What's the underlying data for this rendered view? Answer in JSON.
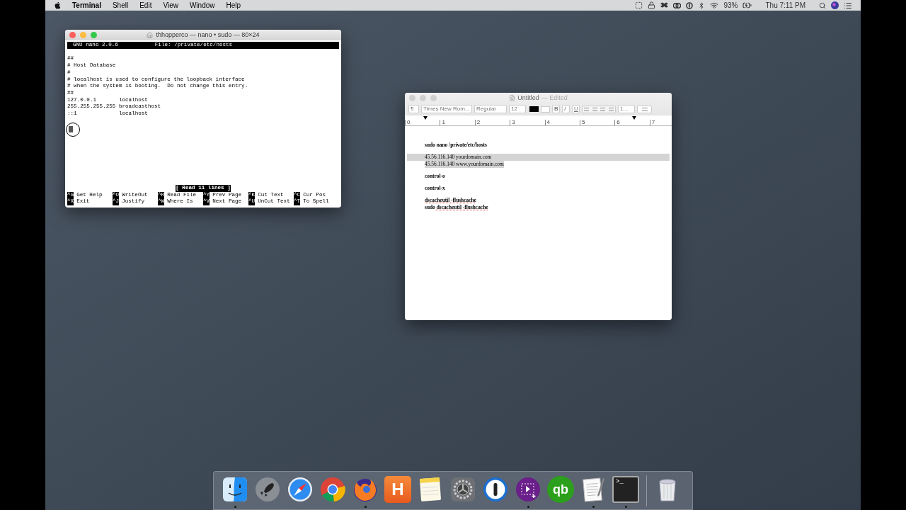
{
  "menu_bar": {
    "app": "Terminal",
    "items": [
      "Shell",
      "Edit",
      "View",
      "Window",
      "Help"
    ],
    "battery": "93%",
    "clock": "Thu 7:11 PM"
  },
  "terminal": {
    "title": "thhopperco — nano • sudo — 80×24",
    "header_left": "GNU nano 2.0.6",
    "header_file": "File: /private/etc/hosts",
    "lines": [
      "##",
      "# Host Database",
      "#",
      "# localhost is used to configure the loopback interface",
      "# when the system is booting.  Do not change this entry.",
      "##",
      "127.0.0.1       localhost",
      "255.255.255.255 broadcasthost",
      "::1             localhost"
    ],
    "status": "[ Read 11 lines ]",
    "shortcuts": [
      {
        "key": "^G",
        "label": "Get Help"
      },
      {
        "key": "^O",
        "label": "WriteOut"
      },
      {
        "key": "^R",
        "label": "Read File"
      },
      {
        "key": "^Y",
        "label": "Prev Page"
      },
      {
        "key": "^K",
        "label": "Cut Text"
      },
      {
        "key": "^C",
        "label": "Cur Pos"
      },
      {
        "key": "^X",
        "label": "Exit"
      },
      {
        "key": "^J",
        "label": "Justify"
      },
      {
        "key": "^W",
        "label": "Where Is"
      },
      {
        "key": "^V",
        "label": "Next Page"
      },
      {
        "key": "^U",
        "label": "UnCut Text"
      },
      {
        "key": "^T",
        "label": "To Spell"
      }
    ]
  },
  "textedit": {
    "title": "Untitled",
    "edited": "— Edited",
    "toolbar": {
      "paragraph": "¶",
      "font": "Times New Rom...",
      "style": "Regular",
      "size": "12",
      "bold": "B",
      "italic": "I",
      "underline": "U",
      "spacing": "1..."
    },
    "ruler": [
      "0",
      "1",
      "2",
      "3",
      "4",
      "5",
      "6",
      "7"
    ],
    "lines": [
      {
        "gap": false,
        "bold": true,
        "selected": false,
        "segments": [
          {
            "text": "sudo nano /private/etc/hosts",
            "misspelled": false
          }
        ]
      },
      {
        "gap": true,
        "bold": false,
        "selected": true,
        "segments": [
          {
            "text": "45.56.116.140 yourdomain.com",
            "misspelled": false
          }
        ]
      },
      {
        "gap": false,
        "bold": false,
        "selected": true,
        "segments": [
          {
            "text": "45.56.116.140 www.yourdomain.com",
            "misspelled": false
          }
        ]
      },
      {
        "gap": true,
        "bold": true,
        "selected": false,
        "segments": [
          {
            "text": "control-o",
            "misspelled": false
          }
        ]
      },
      {
        "gap": true,
        "bold": true,
        "selected": false,
        "segments": [
          {
            "text": "control-x",
            "misspelled": false
          }
        ]
      },
      {
        "gap": true,
        "bold": true,
        "selected": false,
        "segments": [
          {
            "text": "dscacheutil -flushcache",
            "misspelled": true
          }
        ]
      },
      {
        "gap": false,
        "bold": true,
        "selected": false,
        "segments": [
          {
            "text": "sudo ",
            "misspelled": false
          },
          {
            "text": "dscacheutil -flushcache",
            "misspelled": true
          }
        ]
      }
    ]
  },
  "dock": [
    {
      "kind": "finder",
      "running": true
    },
    {
      "kind": "launchpad",
      "running": false
    },
    {
      "kind": "safari",
      "running": false
    },
    {
      "kind": "chrome",
      "running": false
    },
    {
      "kind": "firefox",
      "running": true
    },
    {
      "kind": "letter",
      "glyph": "H",
      "running": false
    },
    {
      "kind": "notes",
      "running": false
    },
    {
      "kind": "settings",
      "running": false
    },
    {
      "kind": "password",
      "running": false
    },
    {
      "kind": "screenshot",
      "running": true
    },
    {
      "kind": "quickbooks",
      "glyph": "qb",
      "running": false
    },
    {
      "kind": "textedit",
      "running": true
    },
    {
      "kind": "terminal",
      "glyph": ">_",
      "running": true
    },
    {
      "kind": "trash",
      "running": false
    }
  ]
}
